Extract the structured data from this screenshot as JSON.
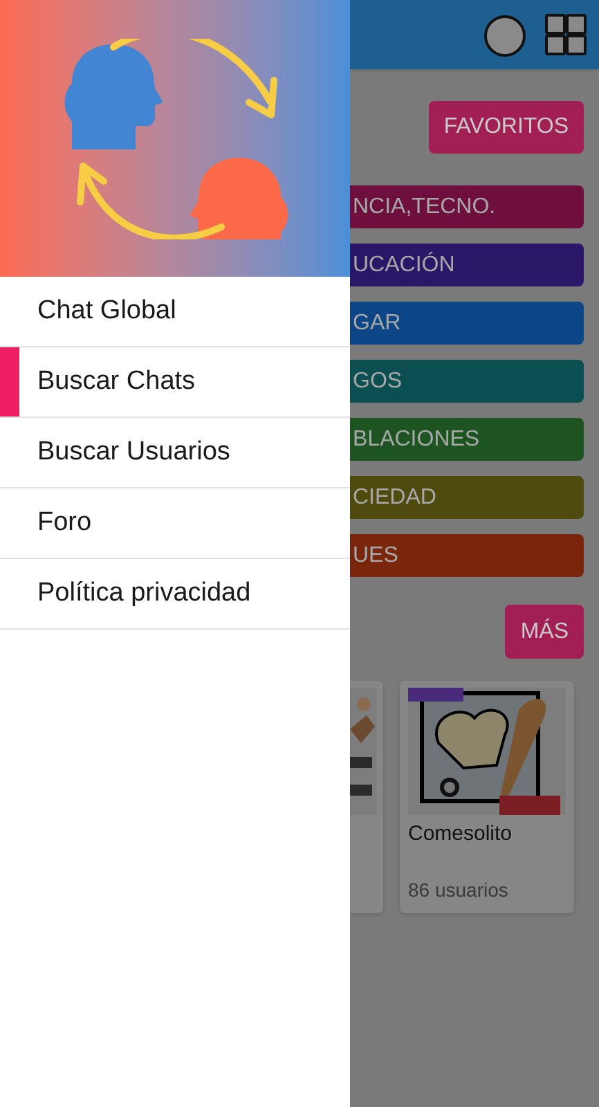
{
  "drawer": {
    "menu": [
      {
        "label": "Chat Global",
        "selected": false
      },
      {
        "label": "Buscar Chats",
        "selected": true
      },
      {
        "label": "Buscar Usuarios",
        "selected": false
      },
      {
        "label": "Foro",
        "selected": false
      },
      {
        "label": "Política privacidad",
        "selected": false
      }
    ]
  },
  "app": {
    "favorites_button": "FAVORITOS",
    "categories": [
      {
        "label": "NCIA,TECNO.",
        "color": "#6e0f3e"
      },
      {
        "label": "UCACIÓN",
        "color": "#2a1768"
      },
      {
        "label": "GAR",
        "color": "#0c4686"
      },
      {
        "label": "GOS",
        "color": "#0b4f52"
      },
      {
        "label": "BLACIONES",
        "color": "#1d5421"
      },
      {
        "label": "CIEDAD",
        "color": "#4f4a0e"
      },
      {
        "label": "UES",
        "color": "#7a260c"
      }
    ],
    "more_button": "MÁS",
    "groups": [
      {
        "title": "Comesolito",
        "members": "86 usuarios"
      }
    ]
  }
}
